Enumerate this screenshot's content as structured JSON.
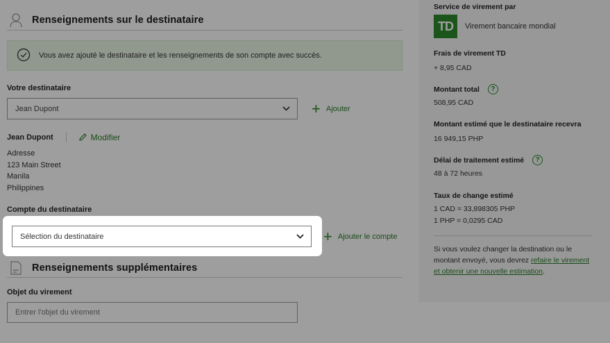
{
  "recipient_section": {
    "title": "Renseignements sur le destinataire",
    "success_message": "Vous avez ajouté le destinataire et les renseignements de son compte avec succès.",
    "your_recipient_label": "Votre destinataire",
    "recipient_select_value": "Jean Dupont",
    "add_label": "Ajouter",
    "recipient_name": "Jean Dupont",
    "modify_label": "Modifier",
    "address_label": "Adresse",
    "address_lines": [
      "123 Main Street",
      "Manila",
      "Philippines"
    ],
    "account_label": "Compte du destinataire",
    "account_select_value": "Sélection du destinataire",
    "add_account_label": "Ajouter le compte"
  },
  "additional_section": {
    "title": "Renseignements supplémentaires",
    "purpose_label": "Objet du virement",
    "purpose_placeholder": "Entrer l'objet du virement"
  },
  "summary": {
    "service_label": "Service de virement par",
    "logo_text": "TD",
    "service_name": "Virement bancaire mondial",
    "fee_label": "Frais de virement TD",
    "fee_value": "+ 8,95 CAD",
    "total_label": "Montant total",
    "total_value": "508,95 CAD",
    "estimated_received_label": "Montant estimé que le destinataire recevra",
    "estimated_received_value": "16 949,15 PHP",
    "processing_label": "Délai de traitement estimé",
    "processing_value": "48 à 72 heures",
    "rate_label": "Taux de change estimé",
    "rate_line_1": "1 CAD = 33,898305 PHP",
    "rate_line_2": "1 PHP = 0,0295 CAD",
    "note_prefix": "Si vous voulez changer la destination ou le montant envoyé, vous devrez ",
    "note_link": "refaire le virement et obtenir une nouvelle estimation",
    "note_suffix": ".",
    "help_glyph": "?"
  },
  "colors": {
    "brand_green": "#2d8a2d",
    "link_green": "#2a7a2a",
    "success_bg": "#eaf6e6"
  },
  "icons": [
    "person-icon",
    "check-circle-icon",
    "chevron-down-icon",
    "plus-icon",
    "pencil-icon",
    "document-icon",
    "help-icon"
  ]
}
